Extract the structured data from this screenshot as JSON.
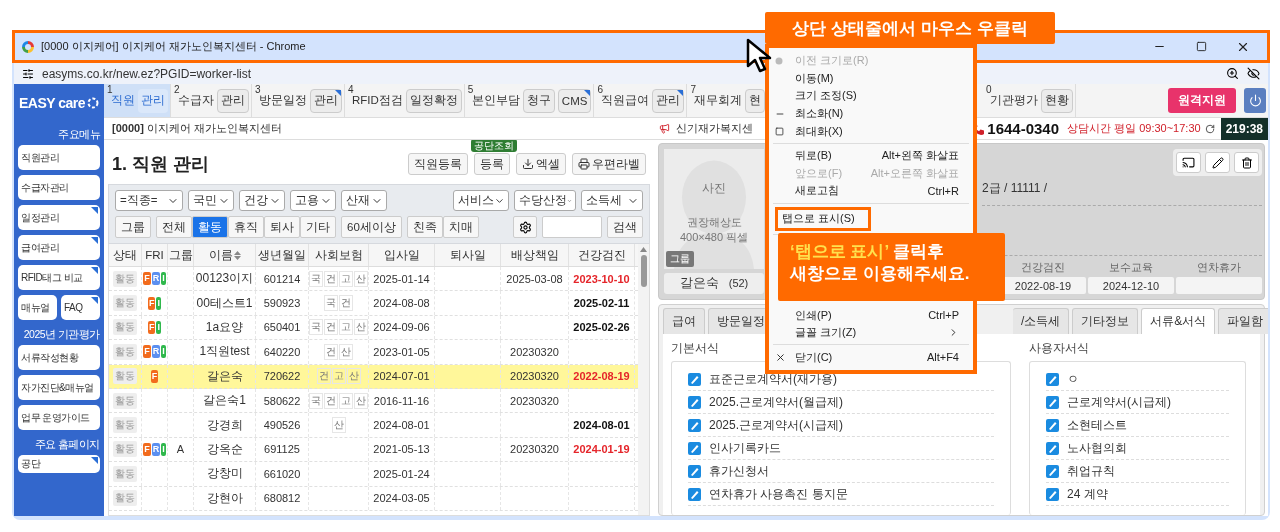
{
  "window": {
    "title": "[0000 이지케어] 이지케어 재가노인복지센터 - Chrome",
    "url": "easyms.co.kr/new.ez?PGID=worker-list"
  },
  "sidebar": {
    "logo": "EASY care",
    "sections": [
      {
        "heading": "주요메뉴",
        "items": [
          {
            "label": "직원관리",
            "marked": false,
            "kind": "full"
          },
          {
            "label": "수급자관리",
            "marked": false,
            "kind": "full"
          },
          {
            "label": "일정관리",
            "marked": true,
            "kind": "full"
          },
          {
            "label": "급여관리",
            "marked": true,
            "kind": "full"
          },
          {
            "label": "RFID태그 비교",
            "marked": true,
            "kind": "full"
          },
          {
            "label": "매뉴얼",
            "marked": false,
            "kind": "half"
          },
          {
            "label": "FAQ",
            "marked": true,
            "kind": "half"
          }
        ]
      },
      {
        "heading": "2025년 기관평가",
        "items": [
          {
            "label": "서류작성현황",
            "marked": false,
            "kind": "full"
          },
          {
            "label": "자가진단&매뉴얼",
            "marked": false,
            "kind": "full"
          },
          {
            "label": "업무 운영가이드",
            "marked": false,
            "kind": "full"
          }
        ]
      },
      {
        "heading": "주요 홈페이지",
        "items": [
          {
            "label": "공단",
            "marked": true,
            "kind": "small"
          }
        ]
      }
    ]
  },
  "nav": [
    {
      "number": "1",
      "label": "직원",
      "selected": true,
      "buttons": [
        {
          "label": "관리",
          "marked": false
        }
      ]
    },
    {
      "number": "2",
      "label": "수급자",
      "selected": false,
      "buttons": [
        {
          "label": "관리",
          "marked": false
        }
      ]
    },
    {
      "number": "3",
      "label": "방문일정",
      "selected": false,
      "buttons": [
        {
          "label": "관리",
          "marked": true
        }
      ]
    },
    {
      "number": "4",
      "label": "RFID점검",
      "selected": false,
      "buttons": [
        {
          "label": "일정확정",
          "marked": false
        }
      ]
    },
    {
      "number": "5",
      "label": "본인부담",
      "selected": false,
      "buttons": [
        {
          "label": "청구",
          "marked": false
        },
        {
          "label": "CMS",
          "marked": true
        }
      ]
    },
    {
      "number": "6",
      "label": "직원급여",
      "selected": false,
      "buttons": [
        {
          "label": "관리",
          "marked": true
        }
      ]
    },
    {
      "number": "7",
      "label": "재무회계",
      "selected": false,
      "buttons": [
        {
          "label": "현"
        }
      ]
    },
    {
      "number": "0",
      "label": "기관평가",
      "selected": false,
      "buttons": [
        {
          "label": "현황",
          "marked": false
        }
      ]
    }
  ],
  "remote_button": "원격지원",
  "info_bar": {
    "center": "**[0000]** 이지케어 재가노인복지센터",
    "notice": "신기재가복지센",
    "phone": "1644-0340",
    "hours": "상담시간 평일 09:30~17:30",
    "timer": "219:38"
  },
  "worker_list": {
    "title": "1. 직원 관리",
    "actions": [
      {
        "label": "직원등록",
        "kind": "plain"
      },
      {
        "label": "등록",
        "kind": "badge",
        "badge": "공단조회"
      },
      {
        "label": "엑셀",
        "kind": "download"
      },
      {
        "label": "우편라벨",
        "kind": "print"
      }
    ],
    "selects_left": [
      "=직종=",
      "국민",
      "건강",
      "고용",
      "산재"
    ],
    "selects_right": [
      "서비스",
      "수당산정",
      "소득세"
    ],
    "group_button": "그룹",
    "status_filters": [
      {
        "label": "전체",
        "selected": false
      },
      {
        "label": "활동",
        "selected": true
      },
      {
        "label": "휴직",
        "selected": false
      },
      {
        "label": "퇴사",
        "selected": false
      },
      {
        "label": "기타",
        "selected": false
      }
    ],
    "age_filter": "60세이상",
    "extra_filters": [
      {
        "label": "친족",
        "selected": false
      },
      {
        "label": "치매",
        "selected": false
      }
    ],
    "search_button": "검색",
    "columns": [
      "상태",
      "FRI",
      "그룹",
      "이름",
      "생년월일",
      "사회보험",
      "입사일",
      "퇴사일",
      "배상책임",
      "건강검진"
    ],
    "rows": [
      {
        "selected": false,
        "status": "활동",
        "fri": [
          {
            "letter": "F",
            "color": "#f26b1d"
          },
          {
            "letter": "R",
            "color": "#5b8ff0"
          },
          {
            "letter": "I",
            "color": "#2fb84c"
          }
        ],
        "name": "00123이지",
        "birth": "601214",
        "insurance": [
          "국",
          "건",
          "고",
          "산"
        ],
        "joined": "2025-01-14",
        "liability": "2025-03-08",
        "health": "2023-10-10",
        "overdue": true
      },
      {
        "selected": false,
        "status": "활동",
        "fri": [
          {
            "letter": "F",
            "color": "#f26b1d"
          },
          {
            "letter": "I",
            "color": "#2fb84c"
          }
        ],
        "name": "00테스트1",
        "birth": "590923",
        "insurance": [
          "국",
          "건"
        ],
        "joined": "2024-08-08",
        "health": "2025-02-11",
        "overdue": false
      },
      {
        "selected": false,
        "status": "활동",
        "fri": [
          {
            "letter": "F",
            "color": "#f26b1d"
          },
          {
            "letter": "I",
            "color": "#2fb84c"
          }
        ],
        "name": "1a요양",
        "birth": "650401",
        "insurance": [
          "국",
          "건",
          "고",
          "산"
        ],
        "joined": "2024-09-06",
        "health": "2025-02-26",
        "overdue": false
      },
      {
        "selected": false,
        "status": "활동",
        "fri": [
          {
            "letter": "F",
            "color": "#f26b1d"
          },
          {
            "letter": "R",
            "color": "#5b8ff0"
          },
          {
            "letter": "I",
            "color": "#2fb84c"
          }
        ],
        "name": "1직원test",
        "birth": "640220",
        "insurance": [
          "건",
          "산"
        ],
        "joined": "2023-01-05",
        "liability": "20230320"
      },
      {
        "selected": true,
        "status": "활동",
        "fri": [
          {
            "letter": "F",
            "color": "#f26b1d"
          }
        ],
        "name": "갈은숙",
        "birth": "720622",
        "insurance": [
          "건",
          "고",
          "산"
        ],
        "joined": "2024-07-01",
        "liability": "20230320",
        "health": "2022-08-19",
        "overdue": true
      },
      {
        "selected": false,
        "status": "활동",
        "fri": [],
        "name": "갈은숙1",
        "birth": "580622",
        "insurance": [
          "국",
          "건",
          "고",
          "산"
        ],
        "joined": "2016-11-16",
        "liability": "20230320"
      },
      {
        "selected": false,
        "status": "활동",
        "fri": [],
        "name": "강경희",
        "birth": "490526",
        "insurance": [
          "산"
        ],
        "joined": "2024-08-01",
        "health": "2024-08-01",
        "overdue": false
      },
      {
        "selected": false,
        "status": "활동",
        "fri": [
          {
            "letter": "F",
            "color": "#f26b1d"
          },
          {
            "letter": "R",
            "color": "#5b8ff0"
          },
          {
            "letter": "I",
            "color": "#2fb84c"
          }
        ],
        "group": "A",
        "name": "강옥순",
        "birth": "691125",
        "insurance": [],
        "joined": "2021-05-13",
        "liability": "20230320",
        "health": "2024-01-19",
        "overdue": true
      },
      {
        "selected": false,
        "status": "활동",
        "fri": [],
        "name": "강창미",
        "birth": "661020",
        "insurance": [],
        "joined": "2025-01-24"
      },
      {
        "selected": false,
        "status": "활동",
        "fri": [],
        "name": "강현아",
        "birth": "680812",
        "insurance": [],
        "joined": "2024-03-05"
      }
    ]
  },
  "profile": {
    "photo_label": "사진",
    "photo_hint": [
      "권장해상도",
      "400×480 픽셀"
    ],
    "group_badge": "그룹",
    "name": "갈은숙",
    "age": "(52)",
    "detail": "2급 / 11111 /",
    "stats": [
      {
        "label": "건강검진",
        "value": "2022-08-19"
      },
      {
        "label": "보수교육",
        "value": "2024-12-10"
      },
      {
        "label": "연차휴가"
      }
    ]
  },
  "tabs": [
    {
      "label": "급여",
      "selected": false,
      "kind": "full"
    },
    {
      "label": "방문일정",
      "selected": false,
      "kind": "full"
    },
    {
      "label": "/소득세",
      "selected": false,
      "kind": "clipped"
    },
    {
      "label": "기타정보",
      "selected": false,
      "kind": "full"
    },
    {
      "label": "서류&서식",
      "selected": true,
      "kind": "full"
    },
    {
      "label": "파일함",
      "selected": false,
      "kind": "full"
    }
  ],
  "basic_forms": {
    "heading": "기본서식",
    "items": [
      "표준근로계약서(재가용)",
      "2025.근로계약서(월급제)",
      "2025.근로계약서(시급제)",
      "인사기록카드",
      "휴가신청서",
      "연차휴가 사용촉진 통지문"
    ]
  },
  "user_forms": {
    "heading": "사용자서식",
    "items": [
      "ㅇ",
      "근로계약서(시급제)",
      "소현테스트",
      "노사협의회",
      "취업규칙",
      "24 계약"
    ]
  },
  "context_menu": {
    "items_top": [
      {
        "kind": "restore",
        "label": "이전 크기로(R)",
        "disabled": true
      },
      {
        "kind": "item",
        "label": "이동(M)",
        "disabled": false
      },
      {
        "kind": "item",
        "label": "크기 조정(S)",
        "disabled": false
      },
      {
        "kind": "minimize",
        "label": "최소화(N)",
        "disabled": false
      },
      {
        "kind": "maximize",
        "label": "최대화(X)",
        "disabled": false
      },
      {
        "kind": "separator"
      },
      {
        "kind": "item",
        "label": "뒤로(B)",
        "shortcut": "Alt+왼쪽 화살표",
        "disabled": false
      },
      {
        "kind": "item",
        "label": "앞으로(F)",
        "shortcut": "Alt+오른쪽 화살표",
        "disabled": true
      },
      {
        "kind": "item",
        "label": "새로고침",
        "shortcut": "Ctrl+R",
        "disabled": false
      },
      {
        "kind": "separator"
      },
      {
        "kind": "item",
        "label": "탭으로 표시(S)",
        "disabled": false,
        "highlighted": true
      },
      {
        "kind": "separator"
      }
    ],
    "items_bottom": [
      {
        "kind": "item",
        "label": "인쇄(P)",
        "shortcut": "Ctrl+P",
        "disabled": false
      },
      {
        "kind": "item",
        "label": "글꼴 크기(Z)",
        "disabled": false,
        "submenu": true
      },
      {
        "kind": "separator"
      },
      {
        "kind": "close",
        "label": "닫기(C)",
        "shortcut": "Alt+F4",
        "disabled": false
      }
    ]
  },
  "callout_top": "상단 상태줄에서 마우스 우클릭",
  "callout_bottom": [
    [
      {
        "text": "‘탭으로 표시’",
        "highlight": true
      },
      {
        "text": " 클릭후",
        "highlight": false
      }
    ],
    [
      {
        "text": "새창으로 이용해주세요.",
        "highlight": false
      }
    ]
  ]
}
